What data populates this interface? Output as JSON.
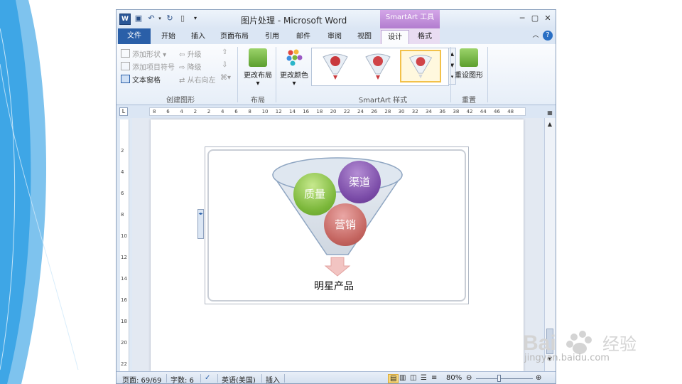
{
  "window": {
    "title": "图片处理 - Microsoft Word",
    "app_icon": "W",
    "contextual_tab_group": "SmartArt 工具"
  },
  "tabs": [
    {
      "label": "文件"
    },
    {
      "label": "开始"
    },
    {
      "label": "插入"
    },
    {
      "label": "页面布局"
    },
    {
      "label": "引用"
    },
    {
      "label": "邮件"
    },
    {
      "label": "审阅"
    },
    {
      "label": "视图"
    },
    {
      "label": "设计"
    },
    {
      "label": "格式"
    }
  ],
  "ribbon": {
    "create_graphic": {
      "label": "创建图形",
      "add_shape": "添加形状",
      "add_bullet": "添加项目符号",
      "text_pane": "文本窗格",
      "promote": "升级",
      "demote": "降级",
      "right_to_left": "从右向左"
    },
    "layouts": {
      "label": "布局",
      "change_layout": "更改布局"
    },
    "styles": {
      "label": "SmartArt 样式",
      "change_colors": "更改颜色"
    },
    "reset": {
      "label": "重置",
      "reset_graphic": "重设图形"
    }
  },
  "ruler": {
    "h_ticks": [
      "8",
      "6",
      "4",
      "2",
      "2",
      "4",
      "6",
      "8",
      "10",
      "12",
      "14",
      "16",
      "18",
      "20",
      "22",
      "24",
      "26",
      "28",
      "30",
      "32",
      "34",
      "36",
      "38",
      "42",
      "44",
      "46",
      "48"
    ],
    "v_ticks": [
      "2",
      "4",
      "6",
      "8",
      "10",
      "12",
      "14",
      "16",
      "18",
      "20",
      "22"
    ]
  },
  "smartart": {
    "items": [
      "质量",
      "渠道",
      "营销"
    ],
    "result": "明星产品"
  },
  "status": {
    "page": "页面: 69/69",
    "words": "字数: 6",
    "language": "英语(美国)",
    "insert_mode": "插入",
    "zoom": "80%"
  },
  "watermark": {
    "text": "jingyan.baidu.com",
    "logo": "Baidu 经验"
  },
  "colors": {
    "file_tab": "#2a5fa8",
    "contextual": "#b27dcf",
    "quality": "#7bb73a",
    "channel": "#7b4ca8",
    "marketing": "#c46560"
  }
}
